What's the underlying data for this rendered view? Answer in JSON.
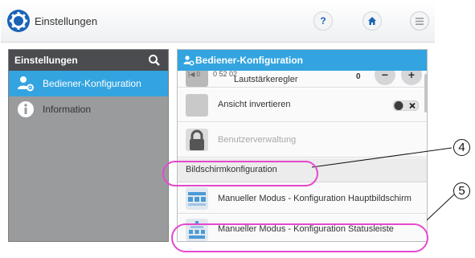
{
  "topbar": {
    "title": "Einstellungen",
    "logo_icon": "gear-icon",
    "help_label": "?",
    "home_icon": "home-icon",
    "menu_icon": "menu-icon"
  },
  "sidebar": {
    "title": "Einstellungen",
    "search_icon": "search-icon",
    "items": [
      {
        "label": "Bediener-Konfiguration",
        "icon": "user-settings-icon",
        "selected": true
      },
      {
        "label": "Information",
        "icon": "info-icon",
        "selected": false
      }
    ]
  },
  "content": {
    "title": "Bediener-Konfiguration",
    "rows": {
      "volume": {
        "tag": "|◀ 0",
        "code": "0 52 02",
        "label": "Lautstärkeregler",
        "value": "0",
        "minus": "−",
        "plus": "+"
      },
      "invert": {
        "label": "Ansicht invertieren",
        "toggle_state": "off"
      },
      "users": {
        "label": "Benutzerverwaltung",
        "disabled": true,
        "icon": "lock-icon"
      }
    },
    "section": "Bildschirmkonfiguration",
    "screens": [
      {
        "label": "Manueller Modus - Konfiguration Hauptbildschirm",
        "icon": "main-screen-icon"
      },
      {
        "label": "Manueller Modus - Konfiguration Statusleiste",
        "icon": "status-bar-icon"
      }
    ]
  },
  "callouts": [
    {
      "number": "4",
      "target": "Bildschirmkonfiguration"
    },
    {
      "number": "5",
      "target": "Manueller Modus - Konfiguration Statusleiste"
    }
  ],
  "colors": {
    "accent": "#33a4e0",
    "sidebar_bg": "#9a9b9d",
    "sidebar_header": "#4a4c4f",
    "callout": "#e548cf"
  }
}
